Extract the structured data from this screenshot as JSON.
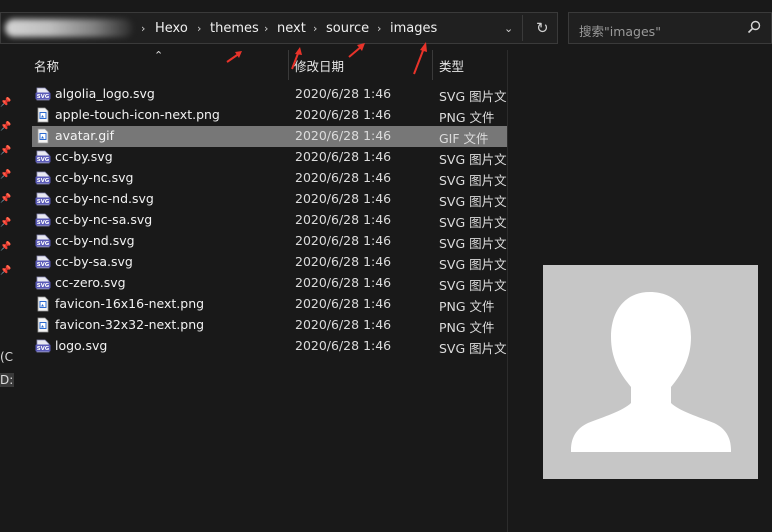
{
  "breadcrumbs": [
    "Hexo",
    "themes",
    "next",
    "source",
    "images"
  ],
  "search": {
    "placeholder": "搜索\"images\""
  },
  "columns": {
    "name": "名称",
    "date": "修改日期",
    "type": "类型"
  },
  "sidebar": {
    "drive_labels": [
      "(C",
      "D:)"
    ]
  },
  "files": [
    {
      "name": "algolia_logo.svg",
      "date": "2020/6/28 1:46",
      "type": "SVG 图片文件",
      "icon": "svg-file-icon"
    },
    {
      "name": "apple-touch-icon-next.png",
      "date": "2020/6/28 1:46",
      "type": "PNG 文件",
      "icon": "png-file-icon"
    },
    {
      "name": "avatar.gif",
      "date": "2020/6/28 1:46",
      "type": "GIF 文件",
      "icon": "gif-file-icon",
      "selected": true
    },
    {
      "name": "cc-by.svg",
      "date": "2020/6/28 1:46",
      "type": "SVG 图片文件",
      "icon": "svg-file-icon"
    },
    {
      "name": "cc-by-nc.svg",
      "date": "2020/6/28 1:46",
      "type": "SVG 图片文件",
      "icon": "svg-file-icon"
    },
    {
      "name": "cc-by-nc-nd.svg",
      "date": "2020/6/28 1:46",
      "type": "SVG 图片文件",
      "icon": "svg-file-icon"
    },
    {
      "name": "cc-by-nc-sa.svg",
      "date": "2020/6/28 1:46",
      "type": "SVG 图片文件",
      "icon": "svg-file-icon"
    },
    {
      "name": "cc-by-nd.svg",
      "date": "2020/6/28 1:46",
      "type": "SVG 图片文件",
      "icon": "svg-file-icon"
    },
    {
      "name": "cc-by-sa.svg",
      "date": "2020/6/28 1:46",
      "type": "SVG 图片文件",
      "icon": "svg-file-icon"
    },
    {
      "name": "cc-zero.svg",
      "date": "2020/6/28 1:46",
      "type": "SVG 图片文件",
      "icon": "svg-file-icon"
    },
    {
      "name": "favicon-16x16-next.png",
      "date": "2020/6/28 1:46",
      "type": "PNG 文件",
      "icon": "png-file-icon"
    },
    {
      "name": "favicon-32x32-next.png",
      "date": "2020/6/28 1:46",
      "type": "PNG 文件",
      "icon": "png-file-icon"
    },
    {
      "name": "logo.svg",
      "date": "2020/6/28 1:46",
      "type": "SVG 图片文件",
      "icon": "svg-file-icon"
    }
  ],
  "colors": {
    "background": "#191919",
    "selected_row": "#777777",
    "annotation_arrow": "#e8332a",
    "preview_bg": "#c6c6c6"
  }
}
